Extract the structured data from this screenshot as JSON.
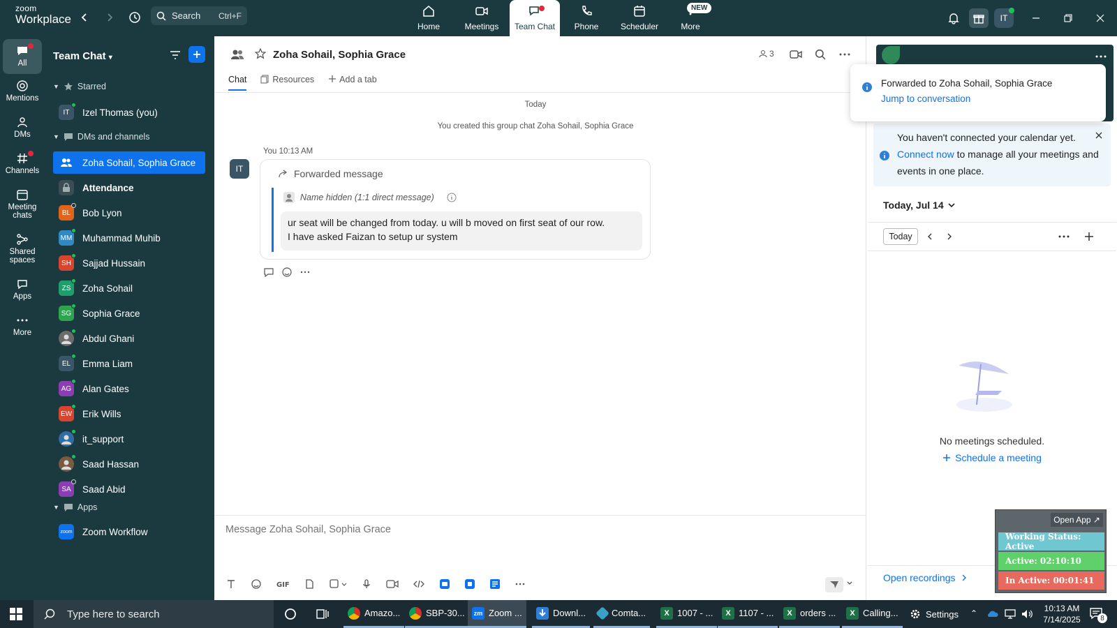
{
  "app": {
    "logo_line1": "zoom",
    "logo_line2": "Workplace",
    "search_label": "Search",
    "search_shortcut": "Ctrl+F"
  },
  "top_tabs": [
    {
      "label": "Home",
      "icon": "home-icon"
    },
    {
      "label": "Meetings",
      "icon": "video-icon"
    },
    {
      "label": "Team Chat",
      "icon": "chat-icon",
      "active": true
    },
    {
      "label": "Phone",
      "icon": "phone-icon"
    },
    {
      "label": "Scheduler",
      "icon": "calendar-icon"
    },
    {
      "label": "More",
      "icon": "more-icon"
    }
  ],
  "new_badge": "NEW",
  "user_initials": "IT",
  "left_rail": [
    {
      "label": "All",
      "icon": "chat-icon"
    },
    {
      "label": "Mentions",
      "icon": "at-icon"
    },
    {
      "label": "DMs",
      "icon": "people-icon"
    },
    {
      "label": "Channels",
      "icon": "hash-icon"
    },
    {
      "label": "Meeting chats",
      "icon": "calendar-icon"
    },
    {
      "label": "Shared spaces",
      "icon": "share-icon"
    },
    {
      "label": "Apps",
      "icon": "apps-icon"
    },
    {
      "label": "More",
      "icon": "more-icon"
    }
  ],
  "sidebar": {
    "title": "Team Chat",
    "starred_label": "Starred",
    "starred": [
      {
        "initials": "IT",
        "name": "Izel Thomas (you)",
        "color": "#3a5566"
      }
    ],
    "dms_label": "DMs and channels",
    "items": [
      {
        "initials": "",
        "name": "Zoha Sohail, Sophia Grace",
        "color": "#0e72ed",
        "active": true,
        "kind": "group"
      },
      {
        "initials": "",
        "name": "Attendance",
        "color": "#3c4e55",
        "bold": true,
        "kind": "lock"
      },
      {
        "initials": "BL",
        "name": "Bob Lyon",
        "color": "#e0651a",
        "status": "away"
      },
      {
        "initials": "MM",
        "name": "Muhammad Muhib",
        "color": "#2f8ac4",
        "status": "online"
      },
      {
        "initials": "SH",
        "name": "Sajjad Hussain",
        "color": "#d8452e",
        "status": "online"
      },
      {
        "initials": "ZS",
        "name": "Zoha Sohail",
        "color": "#1f9d6a",
        "status": "online"
      },
      {
        "initials": "SG",
        "name": "Sophia Grace",
        "color": "#2ea44f",
        "status": "online"
      },
      {
        "initials": "",
        "name": "Abdul Ghani",
        "color": "#6b6b6b",
        "status": "online",
        "kind": "photo"
      },
      {
        "initials": "EL",
        "name": "Emma Liam",
        "color": "#3a5566",
        "status": "online"
      },
      {
        "initials": "AG",
        "name": "Alan Gates",
        "color": "#8a3fb0",
        "status": "online"
      },
      {
        "initials": "EW",
        "name": "Erik Wills",
        "color": "#d8452e",
        "status": "online"
      },
      {
        "initials": "",
        "name": "it_support",
        "color": "#2f6ea3",
        "status": "online",
        "kind": "photo"
      },
      {
        "initials": "",
        "name": "Saad Hassan",
        "color": "#7a5a40",
        "status": "online",
        "kind": "photo"
      },
      {
        "initials": "SA",
        "name": "Saad Abid",
        "color": "#8a3fb0",
        "status": "away"
      }
    ],
    "apps_label": "Apps",
    "apps": [
      {
        "initials": "zoom",
        "name": "Zoom Workflow",
        "color": "#0e72ed"
      }
    ]
  },
  "chat": {
    "title": "Zoha Sohail, Sophia Grace",
    "member_count": "3",
    "tabs": [
      "Chat",
      "Resources",
      "Add a tab"
    ],
    "date_divider": "Today",
    "system_message": "You created this group chat Zoha Sohail, Sophia Grace",
    "sender": "You",
    "time": "10:13 AM",
    "sender_initials": "IT",
    "forwarded_label": "Forwarded message",
    "origin": "Name hidden (1:1 direct message)",
    "message_line1": "ur seat will be changed from today. u will b moved on first seat of our row.",
    "message_line2": "I have asked Faizan to setup ur system",
    "composer_placeholder": "Message Zoha Sohail, Sophia Grace"
  },
  "toast": {
    "text": "Forwarded to Zoha Sohail, Sophia Grace",
    "link": "Jump to conversation"
  },
  "calendar": {
    "note_part1": "You haven't connected your calendar yet.",
    "note_link": "Connect now",
    "note_part2": "to manage all your meetings and events in one place.",
    "date_label": "Today, Jul 14",
    "today_button": "Today",
    "empty_text": "No meetings scheduled.",
    "schedule_link": "Schedule a meeting",
    "recordings_link": "Open recordings"
  },
  "status_widget": {
    "open_app": "Open App ↗",
    "working": "Working Status: Active",
    "active": "Active: 02:10:10",
    "inactive": "In Active: 00:01:41",
    "colors": {
      "working": "#6fc7d2",
      "active": "#5fd06a",
      "inactive": "#e86a5e"
    }
  },
  "taskbar": {
    "search_placeholder": "Type here to search",
    "apps": [
      {
        "label": "Amazo...",
        "icon": "chrome-icon",
        "color": "#d93025"
      },
      {
        "label": "SBP-30...",
        "icon": "chrome-icon",
        "color": "#d93025"
      },
      {
        "label": "Zoom ...",
        "icon": "zoom-icon",
        "color": "#0e72ed"
      },
      {
        "label": "Downl...",
        "icon": "download-icon",
        "color": "#2f7fd6"
      },
      {
        "label": "Comta...",
        "icon": "app-icon",
        "color": "#3aa0c8"
      },
      {
        "label": "1007 - ...",
        "icon": "excel-icon",
        "color": "#1e7145"
      },
      {
        "label": "1107 - ...",
        "icon": "excel-icon",
        "color": "#1e7145"
      },
      {
        "label": "orders ...",
        "icon": "excel-icon",
        "color": "#1e7145"
      },
      {
        "label": "Calling...",
        "icon": "excel-icon",
        "color": "#1e7145"
      },
      {
        "label": "Settings",
        "icon": "gear-icon",
        "color": "#1c2a33"
      }
    ],
    "time": "10:13 AM",
    "date": "7/14/2025",
    "notifications": "8"
  }
}
